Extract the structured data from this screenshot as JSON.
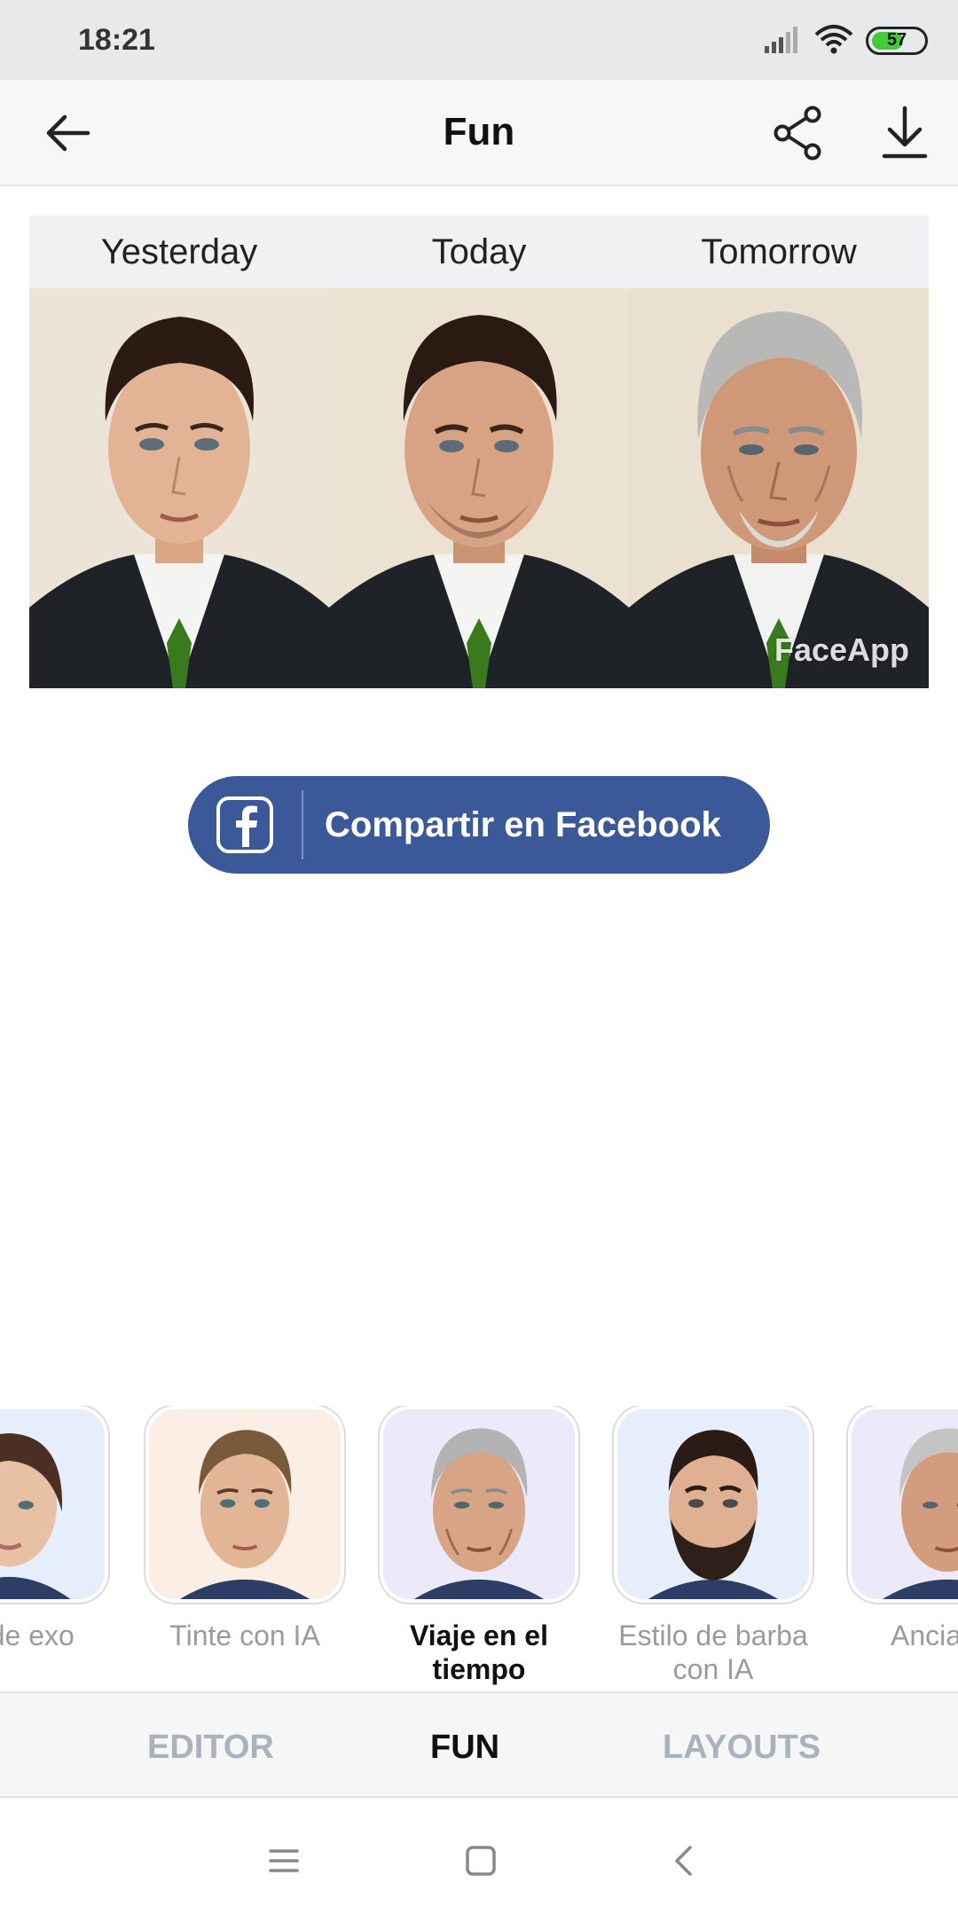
{
  "status_bar": {
    "time": "18:21",
    "battery": "57"
  },
  "app_bar": {
    "title": "Fun"
  },
  "comparison": {
    "labels": [
      "Yesterday",
      "Today",
      "Tomorrow"
    ],
    "watermark": "FaceApp"
  },
  "share": {
    "facebook_label": "Compartir en Facebook"
  },
  "filters": [
    {
      "label": "bio de exo"
    },
    {
      "label": "Tinte con IA"
    },
    {
      "label": "Viaje en el tiempo",
      "selected": true
    },
    {
      "label": "Estilo de barba con IA"
    },
    {
      "label": "Ancia"
    }
  ],
  "tabs": [
    {
      "label": "EDITOR"
    },
    {
      "label": "FUN",
      "selected": true
    },
    {
      "label": "LAYOUTS"
    }
  ],
  "colors": {
    "facebook_blue": "#3b5998",
    "battery_green": "#46c93a",
    "inactive_tab": "#a9b2bd"
  }
}
